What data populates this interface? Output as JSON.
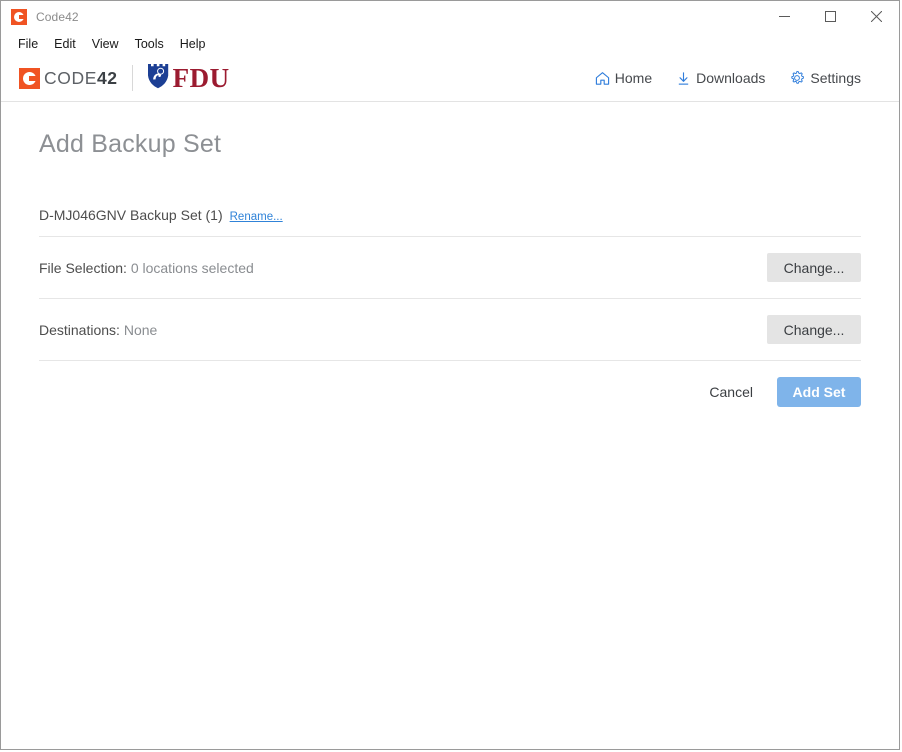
{
  "window": {
    "title": "Code42",
    "app_icon": "code42-app-icon",
    "controls": {
      "minimize": "minimize-icon",
      "maximize": "maximize-icon",
      "close": "close-icon"
    }
  },
  "menubar": {
    "items": [
      {
        "label": "File"
      },
      {
        "label": "Edit"
      },
      {
        "label": "View"
      },
      {
        "label": "Tools"
      },
      {
        "label": "Help"
      }
    ]
  },
  "brand": {
    "code42": {
      "word_light": "CODE",
      "word_bold": "42",
      "mark_icon": "code42-logo-icon",
      "accent": "#f05323"
    },
    "fdu": {
      "word": "FDU",
      "shield_icon": "fdu-shield-icon",
      "shield_color": "#1c3f94",
      "word_color": "#9b1b30"
    }
  },
  "nav": {
    "accent": "#2f7ddb",
    "items": [
      {
        "label": "Home",
        "icon": "home-icon"
      },
      {
        "label": "Downloads",
        "icon": "download-icon"
      },
      {
        "label": "Settings",
        "icon": "gear-icon"
      }
    ]
  },
  "main": {
    "page_title": "Add Backup Set",
    "backup_set": {
      "name": "D-MJ046GNV Backup Set (1)",
      "rename_link": "Rename...",
      "link_color": "#3083d8"
    },
    "file_selection": {
      "label": "File Selection:",
      "value": "0 locations selected",
      "button": "Change..."
    },
    "destinations": {
      "label": "Destinations:",
      "value": "None",
      "button": "Change..."
    },
    "actions": {
      "cancel": "Cancel",
      "submit": "Add Set",
      "submit_color": "#7fb4ea"
    }
  }
}
